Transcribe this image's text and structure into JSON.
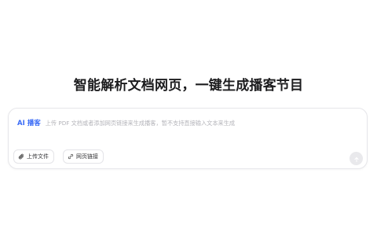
{
  "hero": {
    "title": "智能解析文档网页，一键生成播客节目"
  },
  "composer": {
    "mode_label": "AI 播客",
    "placeholder": "上传 PDF 文档或者添加网页链接来生成播客，暂不支持直接输入文本来生成",
    "value": "",
    "actions": [
      {
        "label": "上传文件",
        "icon": "paperclip-icon"
      },
      {
        "label": "网页链接",
        "icon": "link-icon"
      }
    ],
    "send": {
      "icon": "arrow-up-icon",
      "enabled": false
    }
  },
  "colors": {
    "accent": "#3b6cf6",
    "placeholder": "#b4b4ba",
    "border": "#e6e6ea",
    "send_disabled_bg": "#e9e9ec"
  }
}
